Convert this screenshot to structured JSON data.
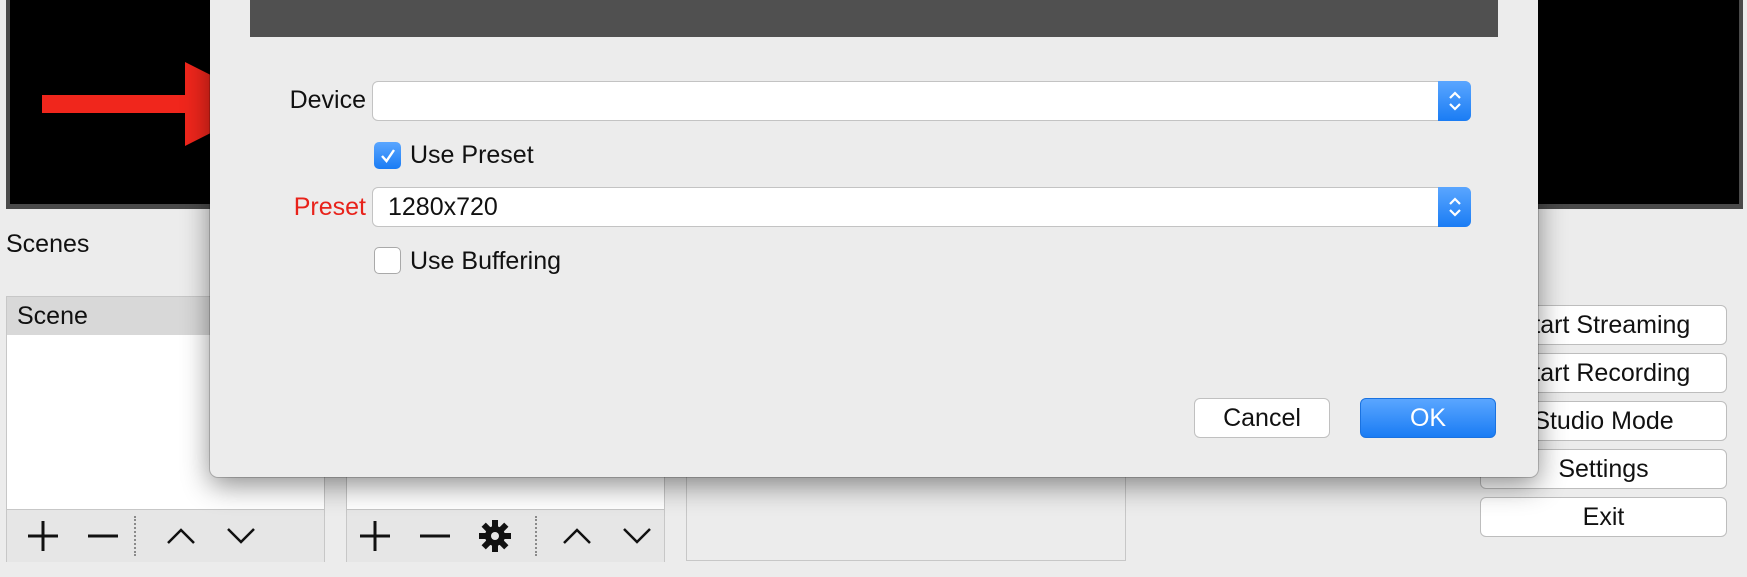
{
  "main_window": {
    "scenes_title": "Scenes",
    "scene_list_header": "Scene",
    "controls": {
      "start_streaming": "Start Streaming",
      "start_recording": "Start Recording",
      "studio_mode": "Studio Mode",
      "settings": "Settings",
      "exit": "Exit"
    },
    "icons": [
      "plus-icon",
      "minus-icon",
      "gear-icon",
      "chevron-up-icon",
      "chevron-down-icon"
    ]
  },
  "dialog": {
    "device_label": "Device",
    "device_value": "",
    "use_preset_label": "Use Preset",
    "use_preset_checked": true,
    "preset_label": "Preset",
    "preset_value": "1280x720",
    "use_buffering_label": "Use Buffering",
    "use_buffering_checked": false,
    "cancel_label": "Cancel",
    "ok_label": "OK"
  },
  "annotation": {
    "arrow_color": "#f0261c",
    "label_highlight_color": "#e8221a"
  },
  "colors": {
    "accent": "#1a7cf4",
    "dialog_bg": "#ececec",
    "preview_bg": "#000000"
  }
}
